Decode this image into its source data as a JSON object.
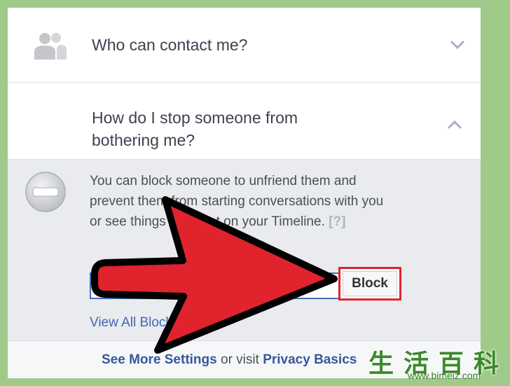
{
  "settings": {
    "items": [
      {
        "label": "Who can contact me?",
        "icon": "people-icon",
        "state": "collapsed"
      },
      {
        "label": "How do I stop someone from bothering me?",
        "icon": "no-entry-icon",
        "state": "expanded"
      }
    ],
    "expanded": {
      "description": "You can block someone to unfriend them and prevent them from starting conversations with you or see things you post on your Timeline.",
      "help_link": "[?]",
      "input_value": "",
      "block_button": "Block",
      "view_all_link": "View All Blocked Users"
    },
    "footer": {
      "see_more": "See More Settings",
      "or_visit": "or visit",
      "privacy": "Privacy Basics"
    }
  },
  "watermark": {
    "chars": "生活百科",
    "url": "www.bimeiz.com"
  },
  "colors": {
    "arrow_fill": "#e0232d",
    "arrow_stroke": "#000000",
    "highlight": "#e0232d",
    "link": "#365899"
  }
}
